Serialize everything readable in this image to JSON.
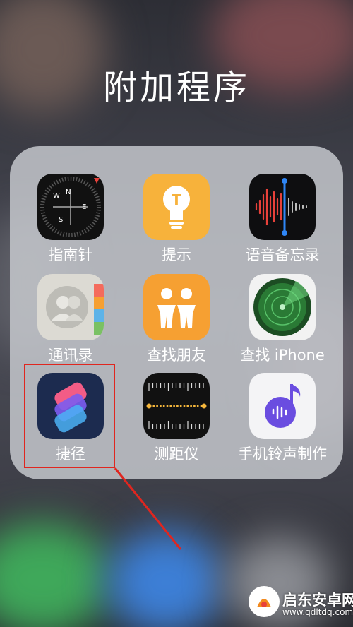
{
  "folder_title": "附加程序",
  "apps": [
    {
      "name": "指南针",
      "icon": "compass-icon"
    },
    {
      "name": "提示",
      "icon": "tips-icon"
    },
    {
      "name": "语音备忘录",
      "icon": "voice-memos-icon"
    },
    {
      "name": "通讯录",
      "icon": "contacts-icon"
    },
    {
      "name": "查找朋友",
      "icon": "find-friends-icon"
    },
    {
      "name": "查找 iPhone",
      "icon": "find-iphone-icon"
    },
    {
      "name": "捷径",
      "icon": "shortcuts-icon"
    },
    {
      "name": "测距仪",
      "icon": "measure-icon"
    },
    {
      "name": "手机铃声制作",
      "icon": "ringtone-maker-icon"
    }
  ],
  "compass_letters": {
    "n": "N",
    "e": "E",
    "s": "S",
    "w": "W"
  },
  "tips_letter": "T",
  "watermark": {
    "name": "启东安卓网",
    "url": "www.qdltdq.com"
  },
  "colors": {
    "highlight": "#e0261f",
    "tips_yellow": "#f7b23b",
    "find_orange": "#f6a032",
    "radar_green": "#3fae4f"
  }
}
